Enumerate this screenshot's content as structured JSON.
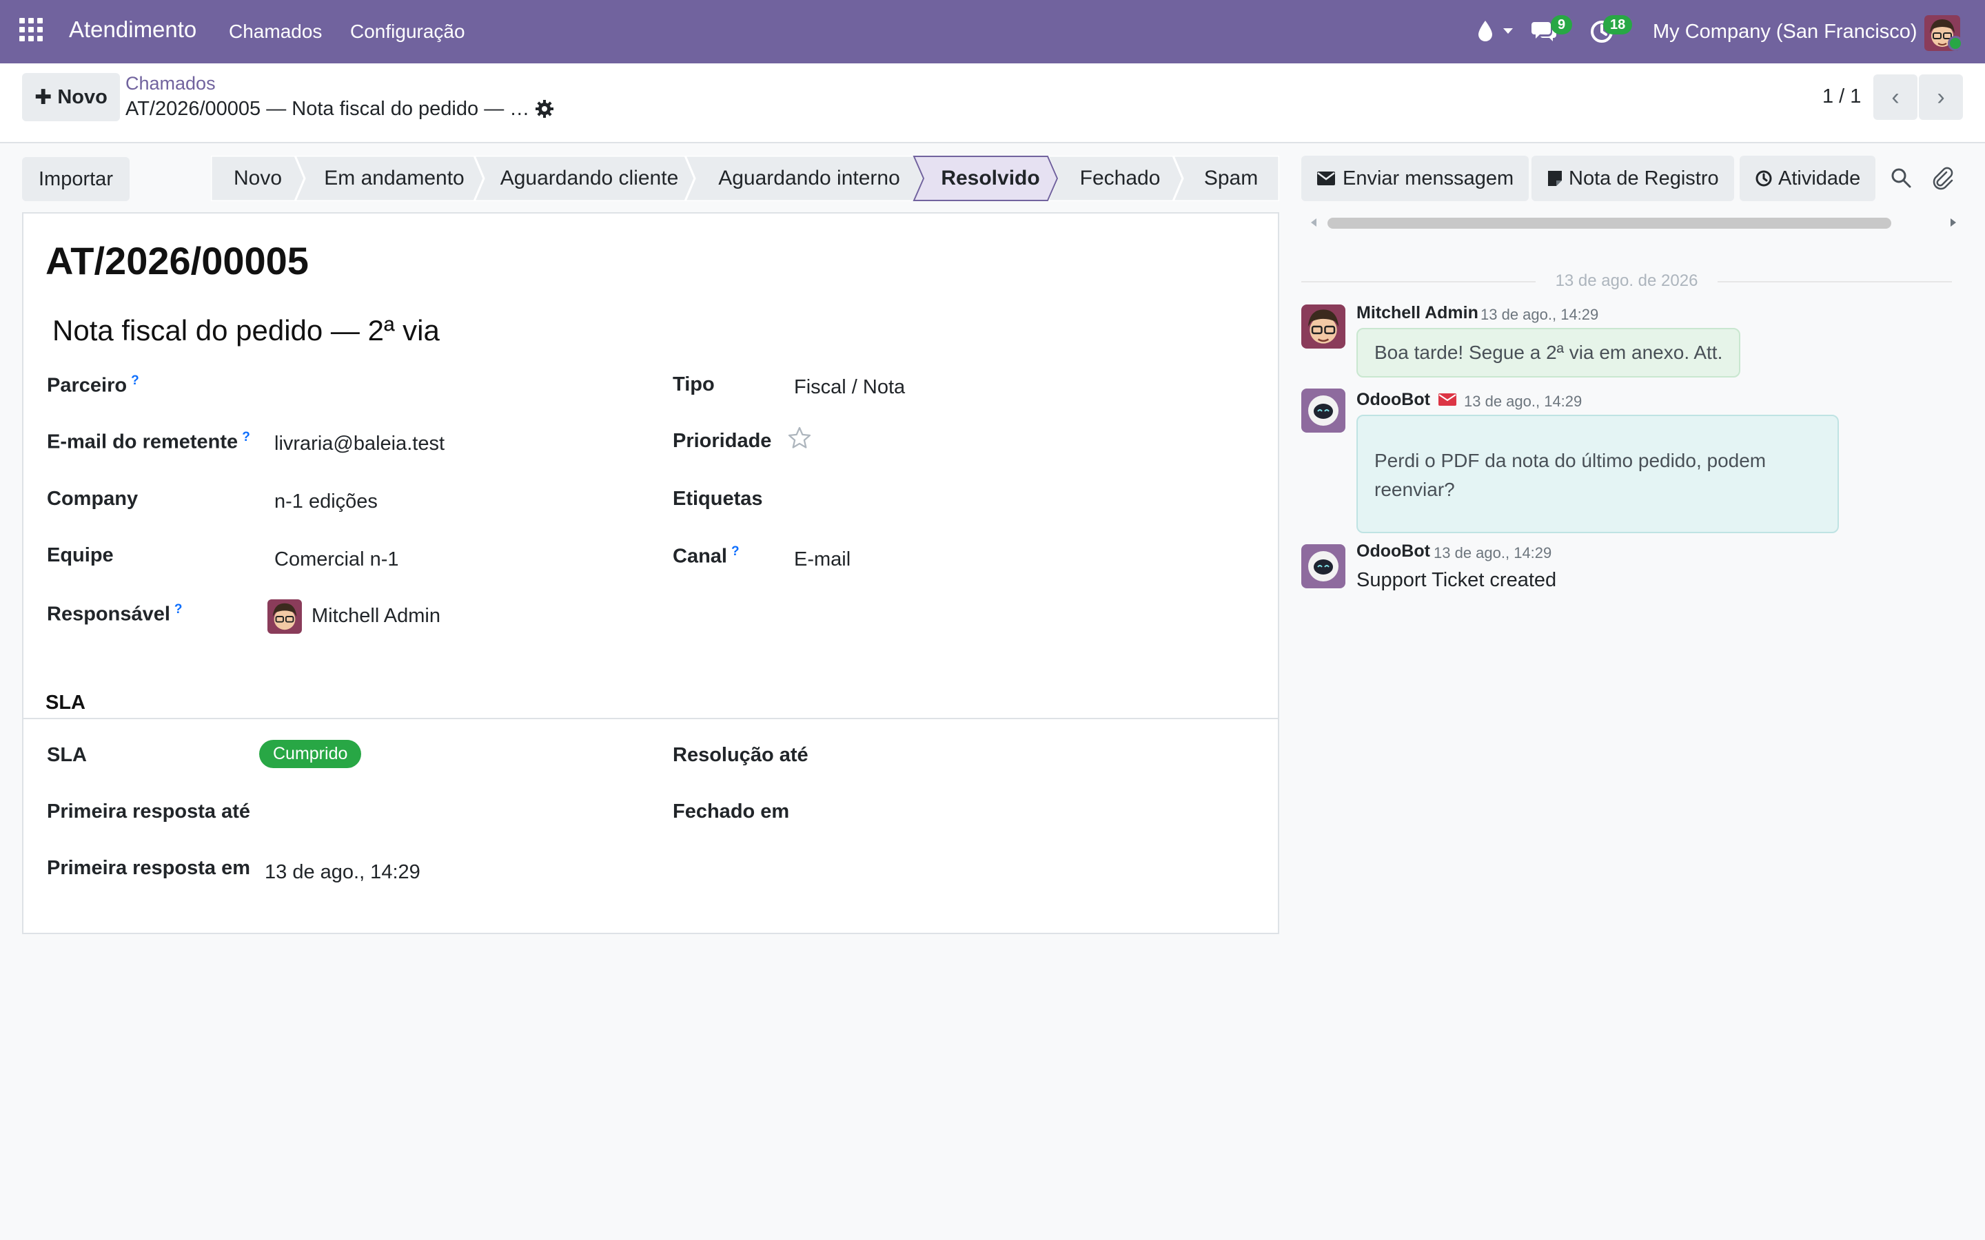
{
  "navbar": {
    "brand": "Atendimento",
    "menu": [
      "Chamados",
      "Configuração"
    ],
    "chat_count": "9",
    "activity_count": "18",
    "company": "My Company (San Francisco)"
  },
  "control": {
    "new_label": "Novo",
    "breadcrumb_parent": "Chamados",
    "breadcrumb_current": "AT/2026/00005 — Nota fiscal do pedido — …",
    "pager": "1 / 1"
  },
  "statusbar": {
    "import_label": "Importar",
    "stages": [
      "Novo",
      "Em andamento",
      "Aguardando cliente",
      "Aguardando interno",
      "Resolvido",
      "Fechado",
      "Spam"
    ],
    "active": "Resolvido"
  },
  "form": {
    "reference": "AT/2026/00005",
    "subject": "Nota fiscal do pedido — 2ª via",
    "left": {
      "partner_label": "Parceiro",
      "email_label": "E-mail do remetente",
      "email_value": "livraria@baleia.test",
      "company_label": "Company",
      "company_value": "n-1 edições",
      "team_label": "Equipe",
      "team_value": "Comercial n-1",
      "owner_label": "Responsável",
      "owner_value": "Mitchell Admin"
    },
    "right": {
      "type_label": "Tipo",
      "type_value": "Fiscal / Nota",
      "priority_label": "Prioridade",
      "tags_label": "Etiquetas",
      "channel_label": "Canal",
      "channel_value": "E-mail"
    },
    "sla_section": {
      "title": "SLA",
      "sla_label": "SLA",
      "sla_status": "Cumprido",
      "first_response_until_label": "Primeira resposta até",
      "first_response_at_label": "Primeira resposta em",
      "first_response_at_value": "13 de ago., 14:29",
      "resolution_until_label": "Resolução até",
      "closed_at_label": "Fechado em"
    }
  },
  "chatter": {
    "send_message": "Enviar menssagem",
    "log_note": "Nota de Registro",
    "activity": "Atividade",
    "date_separator": "13 de ago. de 2026",
    "messages": [
      {
        "author": "Mitchell Admin",
        "time": "13 de ago., 14:29",
        "body": "Boa tarde! Segue a 2ª via em anexo. Att."
      },
      {
        "author": "OdooBot",
        "time": "13 de ago., 14:29",
        "body_line1": "Perdi o PDF da nota do último pedido, podem",
        "body_line2": "reenviar?"
      },
      {
        "author": "OdooBot",
        "time": "13 de ago., 14:29",
        "body": "Support Ticket created"
      }
    ]
  },
  "colors": {
    "brand": "#71639e",
    "success": "#28a745"
  }
}
